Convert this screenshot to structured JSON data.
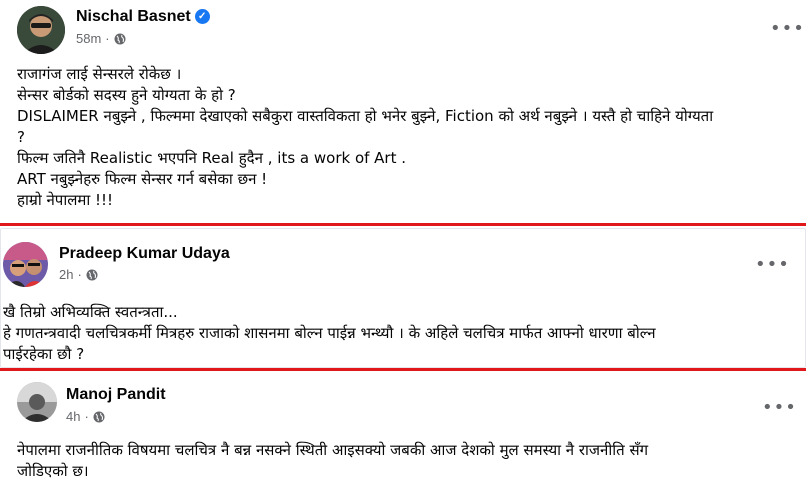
{
  "posts": [
    {
      "author": "Nischal Basnet",
      "time": "58m",
      "lines": [
        "राजागंज लाई सेन्सरले रोकेछ ।",
        "सेन्सर बोर्डको सदस्य हुने योग्यता के हो ?",
        "DISLAIMER नबुझ्ने , फिल्ममा देखाएको सबैकुरा वास्तविकता हो भनेर बुझ्ने, Fiction को अर्थ नबुझ्ने । यस्तै हो चाहिने योग्यता",
        "?",
        "फिल्म जतिनै Realistic भएपनि Real हुदैन , its a work of Art .",
        "ART नबुझ्नेहरु फिल्म सेन्सर गर्न बसेका छन !",
        "हाम्रो नेपालमा !!!"
      ]
    },
    {
      "author": "Pradeep Kumar Udaya",
      "time": "2h",
      "lines": [
        "खै तिम्रो अभिव्यक्ति स्वतन्त्रता...",
        "हे गणतन्त्रवादी चलचित्रकर्मी मित्रहरु राजाको शासनमा बोल्न पाईन्न भन्थ्यौ । के अहिले चलचित्र मार्फत आफ्नो धारणा बोल्न",
        "पाईरहेका छौ ?"
      ]
    },
    {
      "author": "Manoj Pandit",
      "time": "4h",
      "lines": [
        "नेपालमा राजनीतिक विषयमा चलचित्र नै बन्न नसक्ने स्थिती आइसक्यो जबकी आज देशको मुल समस्या नै राजनीति सँग",
        "जोडिएको छ।"
      ]
    }
  ],
  "icons": {
    "more": "more-options-icon",
    "audience": "globe-icon",
    "verified": "verified-badge-icon"
  },
  "colors": {
    "highlight": "#e0181c",
    "verified": "#1877f2"
  }
}
